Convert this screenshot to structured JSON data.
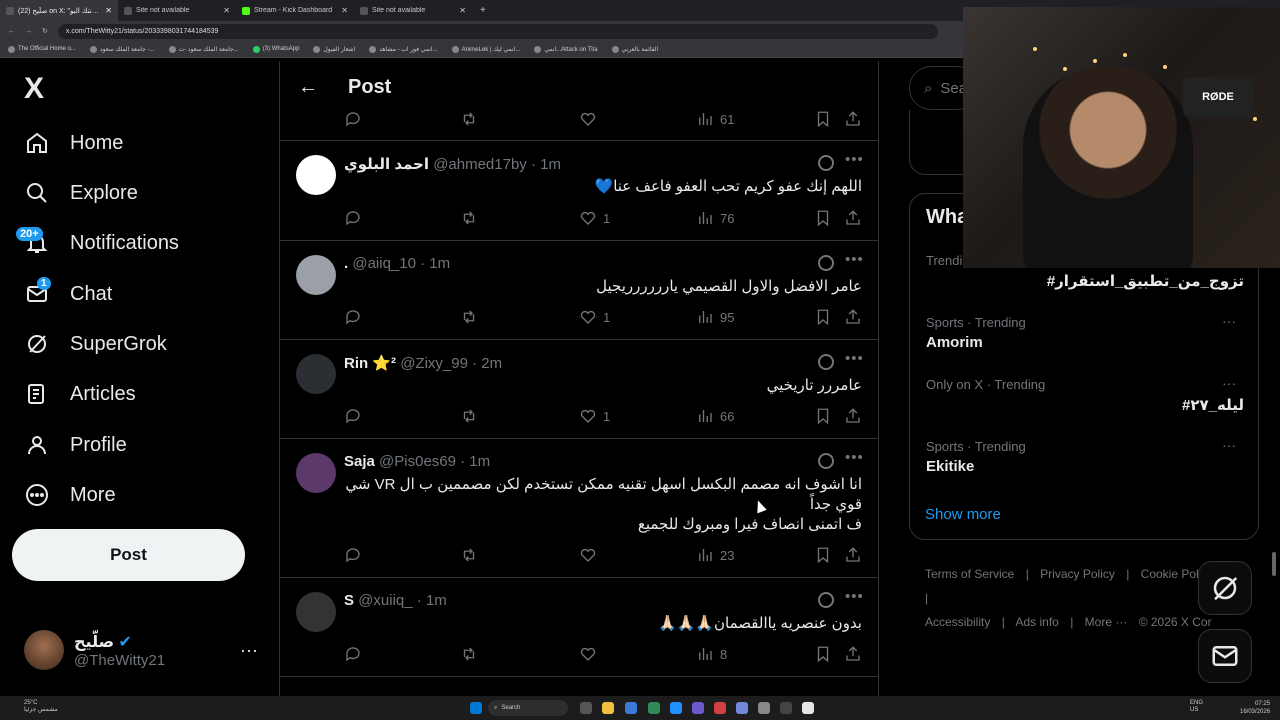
{
  "browser": {
    "tabs": [
      {
        "title": "(22) صلّيح on X: \"الصونتك البو...",
        "close": "✕"
      },
      {
        "title": "Site not available",
        "close": "✕"
      },
      {
        "title": "Stream - Kick Dashboard",
        "close": "✕"
      },
      {
        "title": "Site not available",
        "close": "✕"
      }
    ],
    "new_tab": "+",
    "url": "x.com/TheWitty21/status/2033398031744184539",
    "bookmarks": [
      "The Official Home o...",
      "جامعة الملك سعود -...",
      "جامعة الملك سعود -ت...",
      "(3) WhatsApp",
      "اشعار الفيول",
      "انمي فور اب - مشاهد...",
      "AnimeLek | انمي ليك...",
      "انمي...Attack on Tita",
      "القائمة بالعربي"
    ]
  },
  "nav": {
    "logo": "X",
    "items": [
      {
        "label": "Home"
      },
      {
        "label": "Explore"
      },
      {
        "label": "Notifications",
        "badge": "20+"
      },
      {
        "label": "Chat",
        "badge": "1"
      },
      {
        "label": "SuperGrok"
      },
      {
        "label": "Articles"
      },
      {
        "label": "Profile"
      },
      {
        "label": "More"
      }
    ],
    "post_button": "Post",
    "account": {
      "name": "صلّيح",
      "handle": "@TheWitty21",
      "more": "···"
    }
  },
  "post_header": {
    "back": "←",
    "title": "Post"
  },
  "top_actions": {
    "views": "61"
  },
  "tweets": [
    {
      "name": "احمد البلوي",
      "handle": "@ahmed17by",
      "time": "· 1m",
      "text": "اللهم إنك عفو كريم تحب العفو فاعف عنا💙",
      "likes": "1",
      "views": "76",
      "avatar": "#ffffff"
    },
    {
      "name": ".",
      "handle": "@aiiq_10",
      "time": "· 1m",
      "text": "عامر الافضل والاول القصيمي يارررررريجيل",
      "likes": "1",
      "views": "95",
      "avatar": "#9aa0a6"
    },
    {
      "name": "Rin ⭐²",
      "handle": "@Zixy_99",
      "time": "· 2m",
      "text": "عامررر تاريخيي",
      "likes": "1",
      "views": "66",
      "avatar": "#2b2f33"
    },
    {
      "name": "Saja",
      "handle": "@Pis0es69",
      "time": "· 1m",
      "text_lines": [
        "انا اشوف انه مصمم البكسل اسهل تقنيه ممكن تستخدم لكن مصممين ب ال VR شي",
        "قوي جداً",
        "ف اتمنى انصاف فيرا ومبروك للجميع"
      ],
      "likes": "",
      "views": "23",
      "avatar": "#5b3a6b"
    },
    {
      "name": "S",
      "handle": "@xuiiq_",
      "time": "· 1m",
      "text": "بدون عنصريه ياالقصمان🙏🏻🙏🏻🙏🏻",
      "likes": "",
      "views": "8",
      "avatar": "#333333"
    }
  ],
  "right": {
    "search_placeholder": "Sea",
    "trends_title": "What",
    "trends": [
      {
        "sub": "Trendi",
        "name": "#تزوج_من_تطبيق_استقرار"
      },
      {
        "sub": "Sports · Trending",
        "name": "Amorim"
      },
      {
        "sub": "Only on X · Trending",
        "name": "#ليله_٢٧"
      },
      {
        "sub": "Sports · Trending",
        "name": "Ekitike"
      }
    ],
    "trend_more": "···",
    "show_more": "Show more",
    "footer_row1": [
      "Terms of Service",
      "|",
      "Privacy Policy",
      "|",
      "Cookie Policy",
      "|"
    ],
    "footer_row2": [
      "Accessibility",
      "|",
      "Ads info",
      "|",
      "More ···",
      "© 2026 X Cor"
    ]
  },
  "webcam": {
    "brand": "RØDE"
  },
  "taskbar": {
    "weather_temp": "25°C",
    "weather_desc": "مشمس جزئيا",
    "search": "Search",
    "lang": "ENG",
    "lang_region": "US",
    "time": "07:25",
    "date": "16/03/2026"
  },
  "colors": {
    "accent": "#1d9bf0",
    "bg": "#000000",
    "border": "#2f3336",
    "muted": "#71767b"
  }
}
